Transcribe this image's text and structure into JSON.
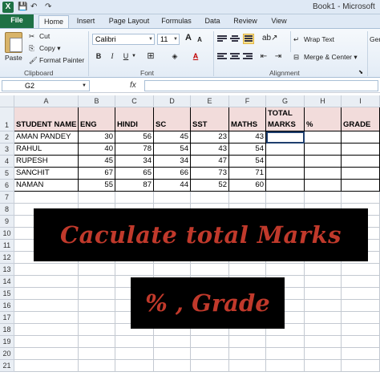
{
  "window": {
    "title": "Book1 - Microsoft",
    "app_icon_letter": "X",
    "quick_access": [
      "💾",
      "↶",
      "↷"
    ]
  },
  "tabs": [
    {
      "label": "File"
    },
    {
      "label": "Home"
    },
    {
      "label": "Insert"
    },
    {
      "label": "Page Layout"
    },
    {
      "label": "Formulas"
    },
    {
      "label": "Data"
    },
    {
      "label": "Review"
    },
    {
      "label": "View"
    }
  ],
  "ribbon": {
    "clipboard": {
      "paste": "Paste",
      "cut": "Cut",
      "copy": "Copy ▾",
      "format_painter": "Format Painter",
      "label": "Clipboard"
    },
    "font": {
      "name": "Calibri",
      "size": "11",
      "label": "Font",
      "bold": "B",
      "italic": "I",
      "underline": "U",
      "grow": "A",
      "shrink": "A",
      "color_letter": "A"
    },
    "alignment": {
      "wrap_text": "Wrap Text",
      "merge_center": "Merge & Center ▾",
      "label": "Alignment",
      "number_format_partial": "Ger"
    }
  },
  "formula_bar": {
    "name_box": "G2",
    "fx": "fx",
    "value": ""
  },
  "grid": {
    "columns": [
      "A",
      "B",
      "C",
      "D",
      "E",
      "F",
      "G",
      "H",
      "I"
    ],
    "rows": [
      "1",
      "2",
      "3",
      "4",
      "5",
      "6",
      "7",
      "8",
      "9",
      "10",
      "11",
      "12",
      "13",
      "14",
      "15",
      "16",
      "17",
      "18",
      "19",
      "20",
      "21"
    ],
    "header_row": [
      "STUDENT NAME",
      "ENG",
      "HINDI",
      "SC",
      "SST",
      "MATHS",
      "TOTAL\nMARKS",
      "%",
      "GRADE"
    ],
    "data_rows": [
      {
        "name": "AMAN PANDEY",
        "eng": "30",
        "hindi": "56",
        "sc": "45",
        "sst": "23",
        "maths": "43"
      },
      {
        "name": "RAHUL",
        "eng": "40",
        "hindi": "78",
        "sc": "54",
        "sst": "43",
        "maths": "54"
      },
      {
        "name": "RUPESH",
        "eng": "45",
        "hindi": "34",
        "sc": "34",
        "sst": "47",
        "maths": "54"
      },
      {
        "name": "SANCHIT",
        "eng": "67",
        "hindi": "65",
        "sc": "66",
        "sst": "73",
        "maths": "71"
      },
      {
        "name": "NAMAN",
        "eng": "55",
        "hindi": "87",
        "sc": "44",
        "sst": "52",
        "maths": "60"
      }
    ]
  },
  "overlay": {
    "line1": "Caculate total Marks",
    "line2": "% , Grade"
  },
  "colors": {
    "header_fill": "#f2dcdb",
    "banner_bg": "#000000",
    "banner_text": "#c0392b",
    "file_tab": "#1e7145"
  }
}
